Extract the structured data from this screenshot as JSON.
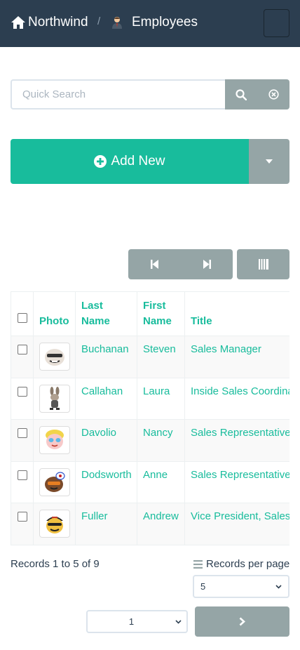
{
  "navbar": {
    "brand": "Northwind",
    "separator": "/",
    "section": "Employees"
  },
  "search": {
    "placeholder": "Quick Search"
  },
  "actions": {
    "add_new": "Add New"
  },
  "table": {
    "columns": [
      "Photo",
      "Last Name",
      "First Name",
      "Title"
    ],
    "rows": [
      {
        "last_name": "Buchanan",
        "first_name": "Steven",
        "title": "Sales Manager"
      },
      {
        "last_name": "Callahan",
        "first_name": "Laura",
        "title": "Inside Sales Coordinator"
      },
      {
        "last_name": "Davolio",
        "first_name": "Nancy",
        "title": "Sales Representative"
      },
      {
        "last_name": "Dodsworth",
        "first_name": "Anne",
        "title": "Sales Representative"
      },
      {
        "last_name": "Fuller",
        "first_name": "Andrew",
        "title": "Vice President, Sales"
      }
    ]
  },
  "footer": {
    "records_info": "Records 1 to 5 of 9",
    "records_per_page_label": "Records per page",
    "records_per_page_value": "5",
    "page_value": "1"
  },
  "icons": {
    "brand": "home-icon",
    "section": "employee-icon",
    "search": "search-icon",
    "clear": "clear-icon",
    "add": "plus-circle-icon",
    "caret": "caret-down-icon",
    "first_page": "first-page-icon",
    "last_page": "last-page-icon",
    "columns": "columns-icon",
    "list": "list-icon",
    "next": "chevron-right-icon"
  },
  "colors": {
    "navbar": "#2c3e50",
    "accent": "#18bc9c",
    "secondary": "#95a5a6",
    "text": "#2c3e50"
  }
}
